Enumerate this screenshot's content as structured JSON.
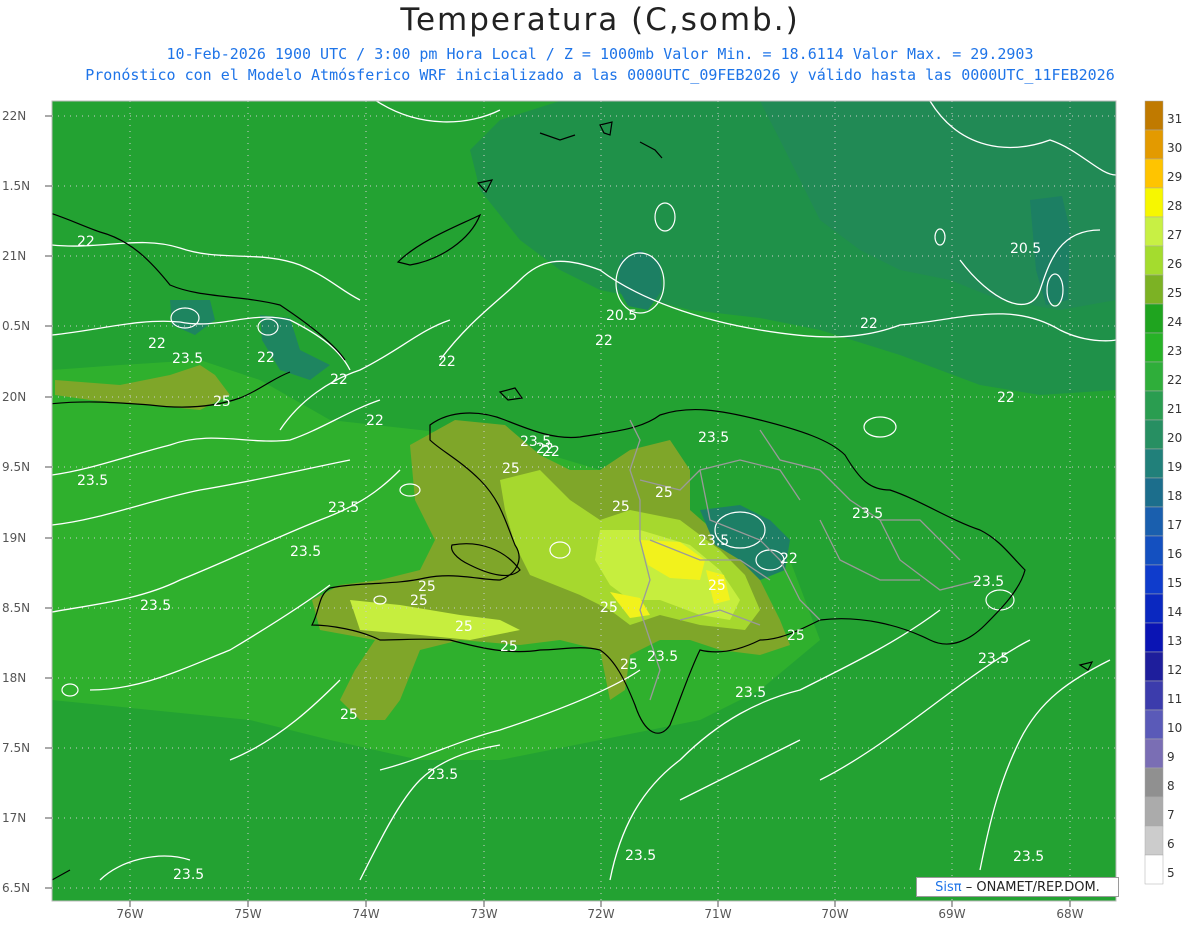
{
  "header": {
    "title": "Temperatura (C,somb.)",
    "line1": "10-Feb-2026  1900 UTC / 3:00 pm Hora Local / Z = 1000mb   Valor Min. = 18.6114  Valor Max. = 29.2903",
    "line2": "Pronóstico con el Modelo Atmósferico WRF inicializado a las 0000UTC_09FEB2026 y válido hasta las  0000UTC_11FEB2026"
  },
  "axes": {
    "lat_labels": [
      "22N",
      "1.5N",
      "21N",
      "0.5N",
      "20N",
      "9.5N",
      "19N",
      "8.5N",
      "18N",
      "7.5N",
      "17N",
      "6.5N"
    ],
    "lon_labels": [
      "76W",
      "75W",
      "74W",
      "73W",
      "72W",
      "71W",
      "70W",
      "69W",
      "68W"
    ]
  },
  "colorbar": {
    "labels": [
      "31",
      "30",
      "29",
      "28",
      "27",
      "26",
      "25",
      "24",
      "23",
      "22",
      "21",
      "20",
      "19",
      "18",
      "17",
      "16",
      "15",
      "14",
      "13",
      "12",
      "11",
      "10",
      "9",
      "8",
      "7",
      "6",
      "5"
    ],
    "colors": [
      "#c07a00",
      "#e39a00",
      "#ffc400",
      "#f7f700",
      "#c8f044",
      "#a4dc2e",
      "#7cb224",
      "#1fa41f",
      "#27b227",
      "#2fae3a",
      "#2a9d50",
      "#278f62",
      "#21807a",
      "#1c6e8c",
      "#1a5fae",
      "#1450c0",
      "#0f3ccc",
      "#0a28c0",
      "#0a14b4",
      "#1e1e9c",
      "#3c3cac",
      "#5a5ab8",
      "#7a6eb4",
      "#909090",
      "#ababab",
      "#cccccc",
      "#ffffff"
    ]
  },
  "contours": [
    "22",
    "22",
    "22",
    "22",
    "22",
    "23.5",
    "20.5",
    "22",
    "22",
    "23.5",
    "25",
    "22",
    "22",
    "22",
    "20.5",
    "23.5",
    "25",
    "25",
    "23.5",
    "25",
    "22",
    "25",
    "23.5",
    "23.5",
    "25",
    "25",
    "23.5",
    "22",
    "23.5",
    "23.5",
    "25",
    "25",
    "25",
    "25",
    "23.5",
    "23.5",
    "25",
    "25",
    "23.5",
    "23.5",
    "23.5",
    "23.5",
    "23.5",
    "23.5"
  ],
  "credit": {
    "sis": "Sisπ",
    "rest": "– ONAMET/REP.DOM."
  },
  "colors": {
    "sea": "#21a131",
    "subtitle": "#1e74e8",
    "land_olive": "#7ea82a",
    "contour": "#ffffff",
    "coast": "#000000",
    "border": "#9a9a9a"
  }
}
